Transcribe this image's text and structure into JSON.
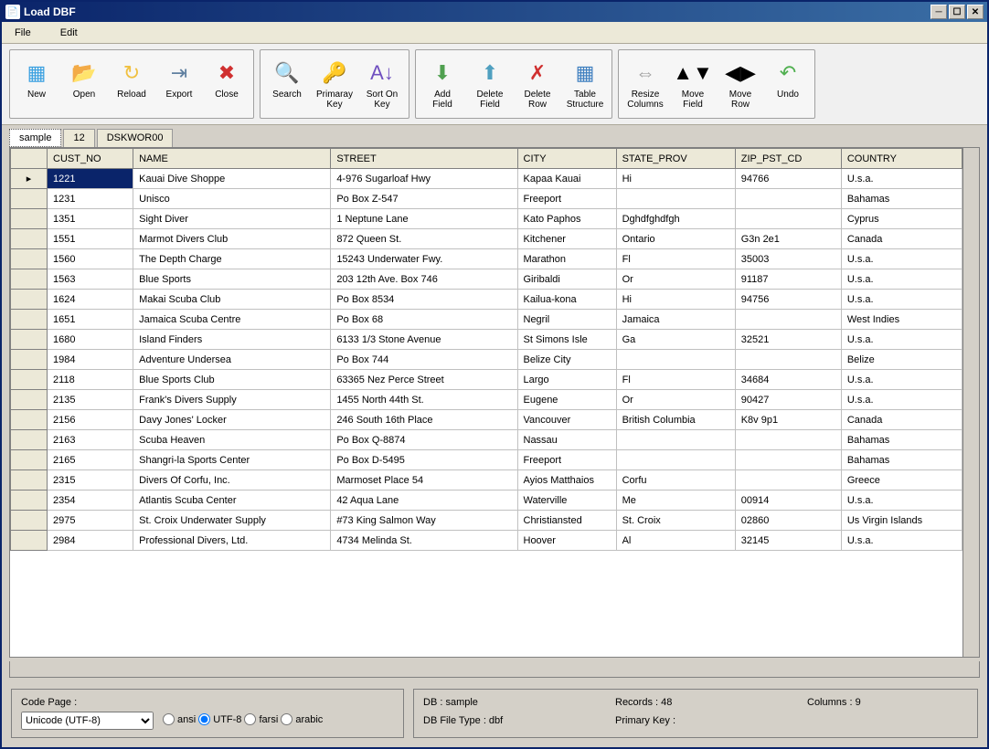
{
  "window": {
    "title": "Load DBF"
  },
  "menu": [
    "File",
    "Edit"
  ],
  "toolbar": [
    {
      "group": 0,
      "items": [
        {
          "id": "new",
          "label": "New",
          "color": "#3aa0e0",
          "glyph": "▦",
          "badge": "+",
          "badgeColor": "#3c3"
        },
        {
          "id": "open",
          "label": "Open",
          "color": "#f0c040",
          "glyph": "📂"
        },
        {
          "id": "reload",
          "label": "Reload",
          "color": "#f0c040",
          "glyph": "↻"
        },
        {
          "id": "export",
          "label": "Export",
          "color": "#6080a0",
          "glyph": "⇥"
        },
        {
          "id": "close",
          "label": "Close",
          "color": "#d03030",
          "glyph": "✖"
        }
      ]
    },
    {
      "group": 1,
      "items": [
        {
          "id": "search",
          "label": "Search",
          "color": "#5090c0",
          "glyph": "🔍"
        },
        {
          "id": "pkey",
          "label": "Primaray\nKey",
          "color": "#e0b020",
          "glyph": "🔑"
        },
        {
          "id": "sort",
          "label": "Sort On\nKey",
          "color": "#7050c0",
          "glyph": "A↓"
        }
      ]
    },
    {
      "group": 2,
      "items": [
        {
          "id": "addfield",
          "label": "Add\nField",
          "color": "#50a050",
          "glyph": "⬇"
        },
        {
          "id": "delfield",
          "label": "Delete\nField",
          "color": "#50a0c0",
          "glyph": "⬆"
        },
        {
          "id": "delrow",
          "label": "Delete\nRow",
          "color": "#d03030",
          "glyph": "✗"
        },
        {
          "id": "structure",
          "label": "Table\nStructure",
          "color": "#4080c0",
          "glyph": "▦"
        }
      ]
    },
    {
      "group": 3,
      "items": [
        {
          "id": "resize",
          "label": "Resize\nColumns",
          "color": "#a0a0a0",
          "glyph": "⇔"
        },
        {
          "id": "movefield",
          "label": "Move\nField",
          "color": "#000",
          "glyph": "▲▼"
        },
        {
          "id": "moverow",
          "label": "Move\nRow",
          "color": "#000",
          "glyph": "◀▶"
        },
        {
          "id": "undo",
          "label": "Undo",
          "color": "#50b050",
          "glyph": "↶"
        }
      ]
    }
  ],
  "tabs": [
    {
      "label": "sample",
      "active": true
    },
    {
      "label": "12",
      "active": false
    },
    {
      "label": "DSKWOR00",
      "active": false
    }
  ],
  "columns": [
    "CUST_NO",
    "NAME",
    "STREET",
    "CITY",
    "STATE_PROV",
    "ZIP_PST_CD",
    "COUNTRY"
  ],
  "rows": [
    [
      "1221",
      "Kauai Dive Shoppe",
      "4-976 Sugarloaf Hwy",
      "Kapaa Kauai",
      "Hi",
      "94766",
      "U.s.a."
    ],
    [
      "1231",
      "Unisco",
      "Po Box Z-547",
      "Freeport",
      "",
      "",
      "Bahamas"
    ],
    [
      "1351",
      "Sight Diver",
      "1 Neptune Lane",
      "Kato Paphos",
      "Dghdfghdfgh",
      "",
      "Cyprus"
    ],
    [
      "1551",
      "Marmot Divers Club",
      "872 Queen St.",
      "Kitchener",
      "Ontario",
      "G3n 2e1",
      "Canada"
    ],
    [
      "1560",
      "The Depth Charge",
      "15243 Underwater Fwy.",
      "Marathon",
      "Fl",
      "35003",
      "U.s.a."
    ],
    [
      "1563",
      "Blue Sports",
      "203 12th Ave. Box 746",
      "Giribaldi",
      "Or",
      "91187",
      "U.s.a."
    ],
    [
      "1624",
      "Makai Scuba Club",
      "Po Box 8534",
      "Kailua-kona",
      "Hi",
      "94756",
      "U.s.a."
    ],
    [
      "1651",
      "Jamaica Scuba Centre",
      "Po Box 68",
      "Negril",
      "Jamaica",
      "",
      "West Indies"
    ],
    [
      "1680",
      "Island Finders",
      "6133 1/3 Stone Avenue",
      "St Simons Isle",
      "Ga",
      "32521",
      "U.s.a."
    ],
    [
      "1984",
      "Adventure Undersea",
      "Po Box 744",
      "Belize City",
      "",
      "",
      "Belize"
    ],
    [
      "2118",
      "Blue Sports Club",
      "63365 Nez Perce Street",
      "Largo",
      "Fl",
      "34684",
      "U.s.a."
    ],
    [
      "2135",
      "Frank's Divers Supply",
      "1455 North 44th St.",
      "Eugene",
      "Or",
      "90427",
      "U.s.a."
    ],
    [
      "2156",
      "Davy Jones' Locker",
      "246 South 16th Place",
      "Vancouver",
      "British Columbia",
      "K8v 9p1",
      "Canada"
    ],
    [
      "2163",
      "Scuba Heaven",
      "Po Box Q-8874",
      "Nassau",
      "",
      "",
      "Bahamas"
    ],
    [
      "2165",
      "Shangri-la Sports Center",
      "Po Box D-5495",
      "Freeport",
      "",
      "",
      "Bahamas"
    ],
    [
      "2315",
      "Divers Of Corfu, Inc.",
      "Marmoset Place 54",
      "Ayios Matthaios",
      "Corfu",
      "",
      "Greece"
    ],
    [
      "2354",
      "Atlantis Scuba Center",
      "42 Aqua Lane",
      "Waterville",
      "Me",
      "00914",
      "U.s.a."
    ],
    [
      "2975",
      "St. Croix Underwater Supply",
      "#73 King Salmon Way",
      "Christiansted",
      "St. Croix",
      "02860",
      "Us Virgin Islands"
    ],
    [
      "2984",
      "Professional Divers, Ltd.",
      "4734 Melinda St.",
      "Hoover",
      "Al",
      "32145",
      "U.s.a."
    ]
  ],
  "selected_cell": {
    "row": 0,
    "col": 0
  },
  "current_row_indicator": 0,
  "codepage": {
    "label": "Code Page :",
    "selected": "Unicode (UTF-8)",
    "radios": [
      "ansi",
      "UTF-8",
      "farsi",
      "arabic"
    ],
    "radio_selected": "UTF-8"
  },
  "status": {
    "db": "DB : sample",
    "filetype": "DB File Type : dbf",
    "records": "Records : 48",
    "pkey": "Primary Key :",
    "columns": "Columns : 9"
  }
}
